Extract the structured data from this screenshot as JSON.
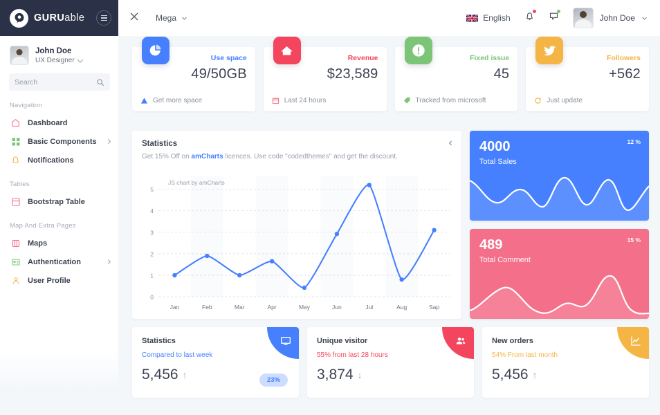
{
  "brand": {
    "bold": "GURU",
    "light": "able",
    "hamburger_icon": "hamburger-icon"
  },
  "sidebar": {
    "profile": {
      "name": "John Doe",
      "role": "UX Designer"
    },
    "search": {
      "placeholder": "Search",
      "value": "",
      "icon": "search-icon"
    },
    "sections": [
      {
        "label": "Navigation",
        "items": [
          {
            "label": "Dashboard",
            "icon": "home-icon",
            "color": "#f4708a",
            "arrow": false
          },
          {
            "label": "Basic Components",
            "icon": "grid-icon",
            "color": "#7cc576",
            "arrow": true
          },
          {
            "label": "Notifications",
            "icon": "bell-icon",
            "color": "#f5b544",
            "arrow": false
          }
        ]
      },
      {
        "label": "Tables",
        "items": [
          {
            "label": "Bootstrap Table",
            "icon": "table-icon",
            "color": "#f4708a",
            "arrow": false
          }
        ]
      },
      {
        "label": "Map And Extra Pages",
        "items": [
          {
            "label": "Maps",
            "icon": "map-pin-icon",
            "color": "#f4708a",
            "arrow": false
          },
          {
            "label": "Authentication",
            "icon": "id-card-icon",
            "color": "#7cc576",
            "arrow": true
          },
          {
            "label": "User Profile",
            "icon": "user-icon",
            "color": "#f5b544",
            "arrow": false
          }
        ]
      }
    ]
  },
  "topbar": {
    "expand_icon": "expand-arrows-icon",
    "mega_label": "Mega",
    "mega_chevron": "chevron-down-icon",
    "language": {
      "label": "English",
      "flag": "uk-flag-icon"
    },
    "bell": {
      "icon": "bell-icon",
      "dot_color": "#f4455e"
    },
    "chat": {
      "icon": "chat-icon",
      "dot_color": "#7cc576"
    },
    "user": {
      "name": "John Doe",
      "avatar": "user-avatar",
      "chevron": "chevron-down-icon"
    }
  },
  "stat_cards": [
    {
      "label": "Use space",
      "value": "49/50GB",
      "foot": "Get more space",
      "foot_icon": "warning-triangle-icon",
      "icon": "pie-chart-icon",
      "color": "#4680ff"
    },
    {
      "label": "Revenue",
      "value": "$23,589",
      "foot": "Last 24 hours",
      "foot_icon": "calendar-icon",
      "icon": "home-icon",
      "color": "#f4455e"
    },
    {
      "label": "Fixed issue",
      "value": "45",
      "foot": "Tracked from microsoft",
      "foot_icon": "tag-icon",
      "icon": "exclamation-icon",
      "color": "#7cc576"
    },
    {
      "label": "Followers",
      "value": "+562",
      "foot": "Just update",
      "foot_icon": "refresh-icon",
      "icon": "twitter-icon",
      "color": "#f5b544"
    }
  ],
  "statistics_panel": {
    "title": "Statistics",
    "subtitle_before": "Get 15% Off on ",
    "subtitle_link": "amCharts",
    "subtitle_after": " licences. Use code \"codedthemes\" and get the discount.",
    "collapse_icon": "chevron-left-icon",
    "watermark": "JS chart by amCharts"
  },
  "chart_data": {
    "type": "line",
    "title": "Statistics",
    "categories": [
      "Jan",
      "Feb",
      "Mar",
      "Apr",
      "May",
      "Jun",
      "Jul",
      "Aug",
      "Sap"
    ],
    "values": [
      1.0,
      1.9,
      1.0,
      1.65,
      0.42,
      2.92,
      5.2,
      0.8,
      3.1
    ],
    "xlabel": "",
    "ylabel": "",
    "ylim": [
      0,
      5.6
    ],
    "yticks": [
      0,
      1,
      2,
      3,
      4,
      5
    ],
    "grid": true,
    "legend": null,
    "series_color": "#4680ff",
    "annotation": "JS chart by amCharts",
    "smooth": true,
    "markers": true
  },
  "mini_cards": [
    {
      "value": "4000",
      "label": "Total Sales",
      "percent": "12 %",
      "color": "#4680ff",
      "spark": "sales-sparkline"
    },
    {
      "value": "489",
      "label": "Total Comment",
      "percent": "15 %",
      "color": "#f4708a",
      "spark": "comment-sparkline"
    }
  ],
  "bottom_cards": [
    {
      "title": "Statistics",
      "sub": "Compared to last week",
      "sub_color": "#4680ff",
      "value": "5,456",
      "trend": "up",
      "trend_icon": "arrow-up-icon",
      "pill": "23%",
      "corner_icon": "monitor-icon",
      "corner_color": "#4680ff"
    },
    {
      "title": "Unique visitor",
      "sub": "55% from last 28 hours",
      "sub_color": "#f4455e",
      "value": "3,874",
      "trend": "down",
      "trend_icon": "arrow-down-icon",
      "pill": null,
      "corner_icon": "users-icon",
      "corner_color": "#f4455e"
    },
    {
      "title": "New orders",
      "sub": "54% From last month",
      "sub_color": "#f5b544",
      "value": "5,456",
      "trend": "up",
      "trend_icon": "arrow-up-icon",
      "pill": null,
      "corner_icon": "chart-line-icon",
      "corner_color": "#f5b544"
    }
  ]
}
